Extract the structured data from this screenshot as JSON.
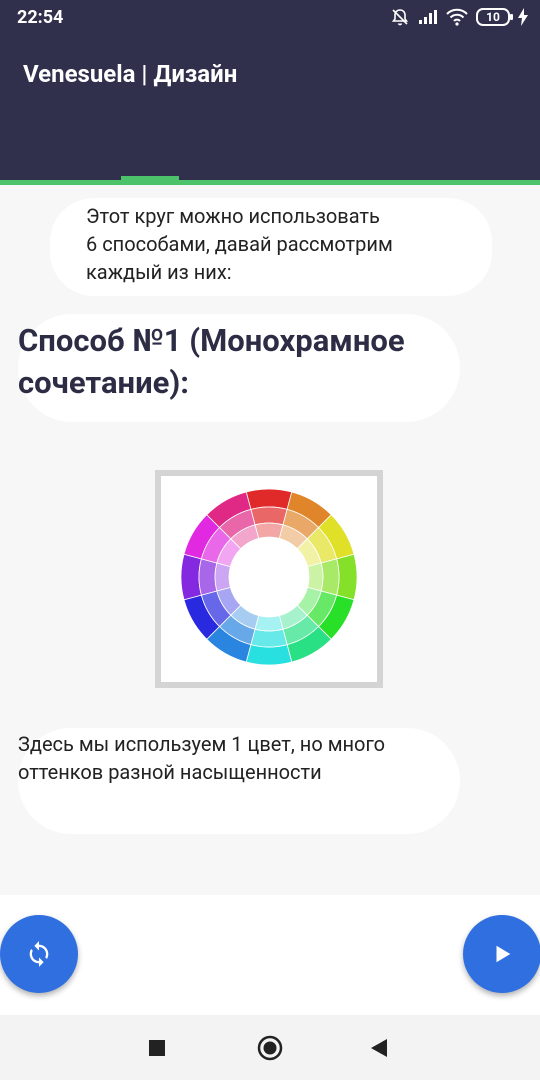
{
  "status_bar": {
    "time": "22:54",
    "battery_level": "10",
    "icons": [
      "muted-bell-icon",
      "signal-icon",
      "wifi-icon",
      "battery-icon",
      "charging-bolt-icon"
    ]
  },
  "header": {
    "title": "Venesuela | Дизайн",
    "background_color": "#30304d",
    "accent_color": "#4cc36b"
  },
  "content": {
    "intro_text": "Этот круг можно использовать\n6 способами, давай рассмотрим\nкаждый из них:",
    "heading": "Способ №1 (Монохрамное\nсочетание):",
    "description": "Здесь мы используем 1 цвет, но много\nоттенков разной насыщенности",
    "image": "color-wheel"
  },
  "actions": {
    "refresh_icon": "refresh-icon",
    "next_icon": "play-arrow-icon",
    "fab_color": "#2f6fe0"
  },
  "navigation": {
    "icons": [
      "recents-square-icon",
      "home-circle-icon",
      "back-triangle-icon"
    ]
  }
}
